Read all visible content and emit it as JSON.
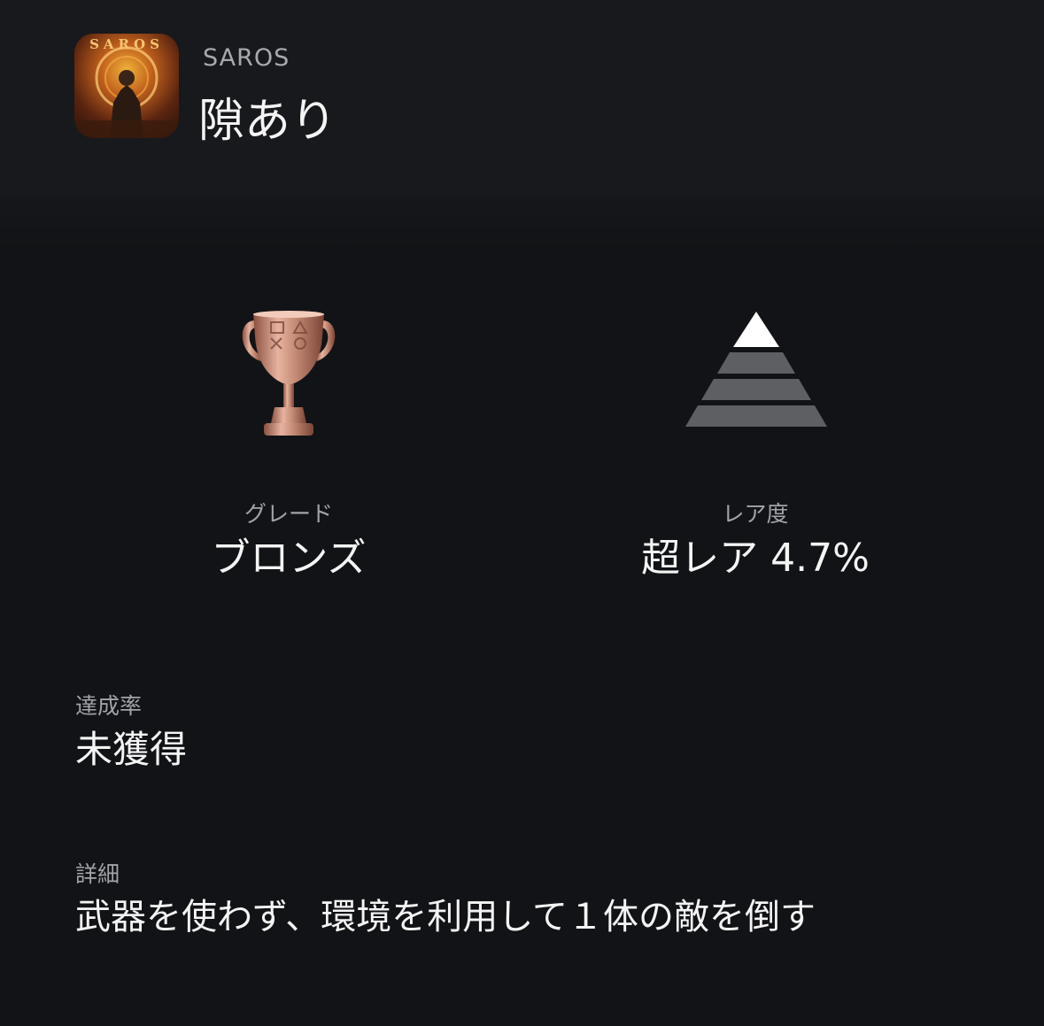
{
  "header": {
    "game_icon": "saros-game-cover",
    "game_icon_logo": "SAROS",
    "game_name": "SAROS",
    "trophy_name": "隙あり"
  },
  "grade": {
    "icon": "bronze-trophy-icon",
    "label": "グレード",
    "value": "ブロンズ",
    "color": "#c48a74"
  },
  "rarity": {
    "icon": "rarity-pyramid-icon",
    "label": "レア度",
    "value": "超レア 4.7%",
    "level": 4,
    "level_max": 4
  },
  "progress": {
    "label": "達成率",
    "value": "未獲得"
  },
  "details": {
    "label": "詳細",
    "value": "武器を使わず、環境を利用して１体の敵を倒す"
  },
  "colors": {
    "background": "#121316",
    "header_background": "#18191c",
    "label_gray": "#a3a4a8",
    "text_white": "#f4f4f4"
  }
}
